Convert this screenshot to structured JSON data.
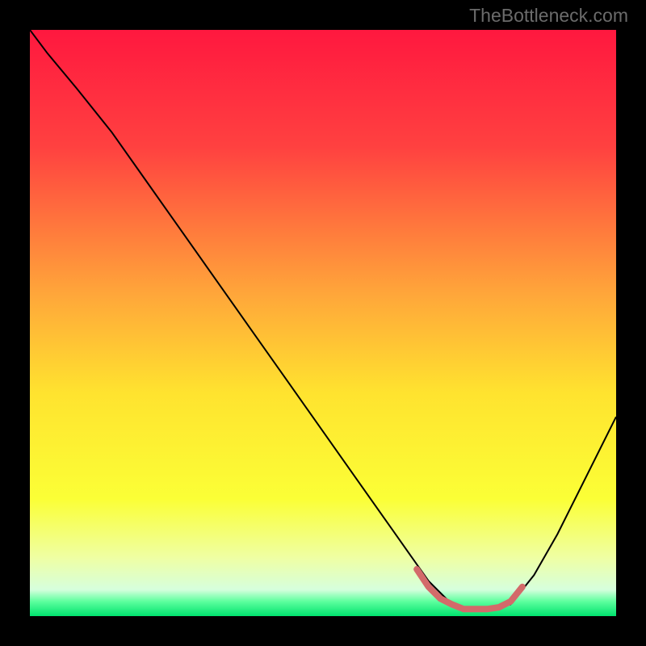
{
  "attribution": "TheBottleneck.com",
  "chart_data": {
    "type": "line",
    "title": "",
    "xlabel": "",
    "ylabel": "",
    "xlim": [
      0,
      100
    ],
    "ylim": [
      0,
      100
    ],
    "gradient_stops": [
      {
        "offset": 0.0,
        "color": "#ff183f"
      },
      {
        "offset": 0.2,
        "color": "#ff4140"
      },
      {
        "offset": 0.45,
        "color": "#ffa63a"
      },
      {
        "offset": 0.62,
        "color": "#ffe32f"
      },
      {
        "offset": 0.8,
        "color": "#fbff36"
      },
      {
        "offset": 0.9,
        "color": "#efffa3"
      },
      {
        "offset": 0.955,
        "color": "#d6ffdd"
      },
      {
        "offset": 0.975,
        "color": "#5dff9e"
      },
      {
        "offset": 1.0,
        "color": "#00e36e"
      }
    ],
    "series": [
      {
        "name": "bottleneck-curve",
        "color": "#000000",
        "width": 2,
        "x": [
          0,
          3,
          8,
          14,
          20,
          26,
          32,
          38,
          44,
          50,
          56,
          62,
          68,
          72,
          75,
          78,
          82,
          86,
          90,
          94,
          98,
          100
        ],
        "y": [
          100,
          96,
          90,
          82.5,
          74,
          65.5,
          57,
          48.5,
          40,
          31.5,
          23,
          14.5,
          6,
          2,
          1,
          1,
          2,
          7,
          14,
          22,
          30,
          34
        ]
      },
      {
        "name": "valley-highlight",
        "color": "#d36a6a",
        "width": 8,
        "linecap": "round",
        "x": [
          66,
          68,
          70,
          72,
          74,
          76,
          78,
          80,
          82,
          84
        ],
        "y": [
          8,
          5,
          3,
          2,
          1.2,
          1.2,
          1.2,
          1.5,
          2.5,
          5
        ]
      }
    ]
  }
}
